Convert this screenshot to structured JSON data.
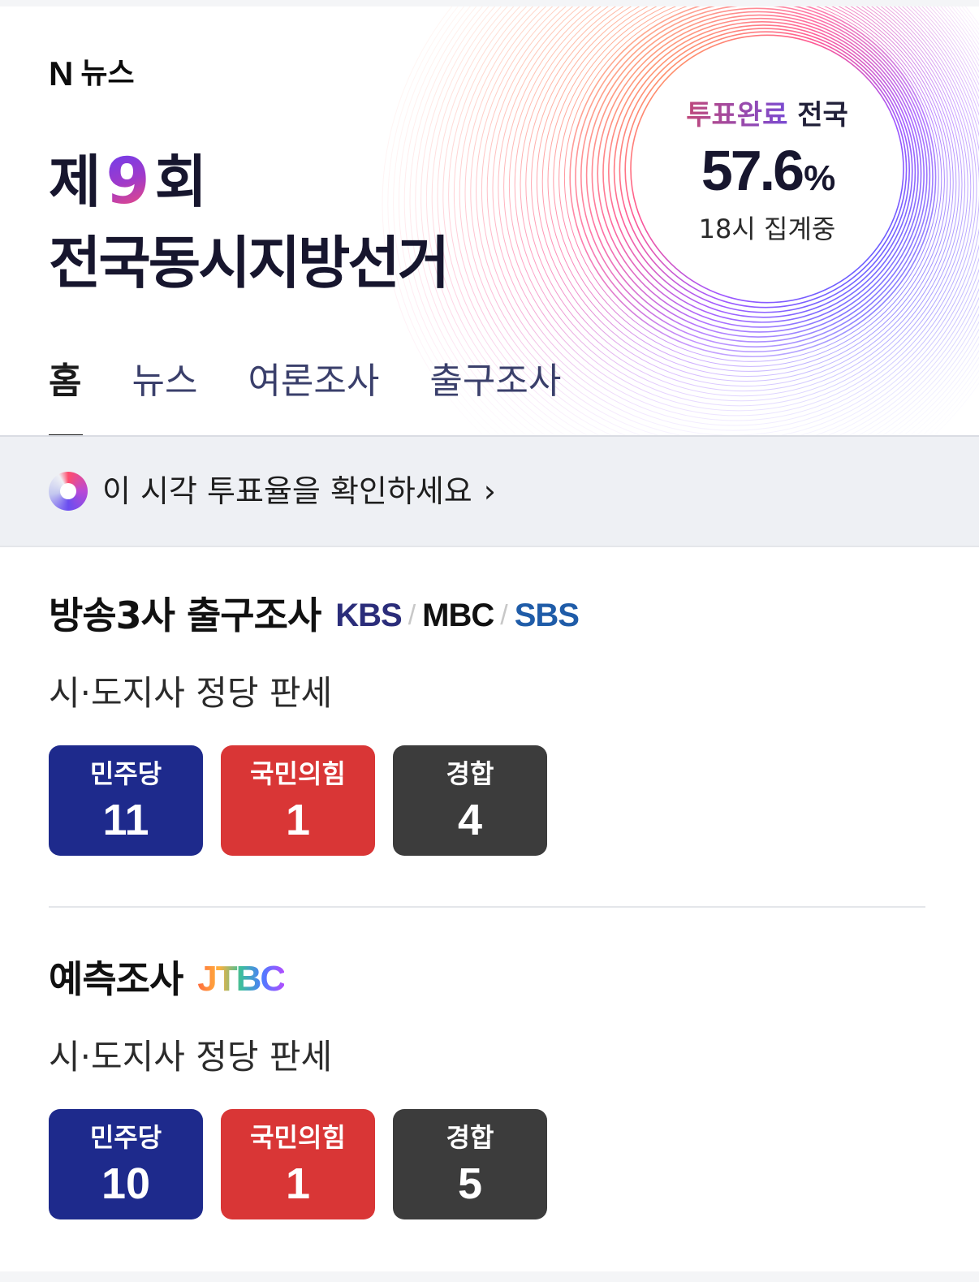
{
  "brand": {
    "n_logo": "N",
    "text": "뉴스"
  },
  "title": {
    "prefix": "제",
    "number": "9",
    "suffix": "회",
    "line2": "전국동시지방선거"
  },
  "turnout": {
    "label_highlight": "투표완료",
    "label_region": "전국",
    "rate": "57.6",
    "unit": "%",
    "status": "18시 집계중"
  },
  "tabs": [
    {
      "label": "홈",
      "active": true
    },
    {
      "label": "뉴스",
      "active": false
    },
    {
      "label": "여론조사",
      "active": false
    },
    {
      "label": "출구조사",
      "active": false
    }
  ],
  "banner": {
    "text": "이 시각 투표율을 확인하세요",
    "chevron": "›"
  },
  "exit_poll": {
    "title": "방송3사 출구조사",
    "broadcasters": [
      "KBS",
      "MBC",
      "SBS"
    ],
    "separator": "/",
    "subtitle": "시·도지사 정당 판세",
    "cards": [
      {
        "party": "민주당",
        "seats": "11",
        "color": "#1e2a8c"
      },
      {
        "party": "국민의힘",
        "seats": "1",
        "color": "#d93636"
      },
      {
        "party": "경합",
        "seats": "4",
        "color": "#3c3c3c"
      }
    ]
  },
  "forecast_poll": {
    "title": "예측조사",
    "broadcaster": "JTBC",
    "subtitle": "시·도지사 정당 판세",
    "cards": [
      {
        "party": "민주당",
        "seats": "10",
        "color": "#1e2a8c"
      },
      {
        "party": "국민의힘",
        "seats": "1",
        "color": "#d93636"
      },
      {
        "party": "경합",
        "seats": "5",
        "color": "#3c3c3c"
      }
    ]
  },
  "icons": {
    "turnout_ring": "ring-art",
    "banner_donut": "donut-chart-icon",
    "banner_chevron": "chevron-right-icon"
  }
}
